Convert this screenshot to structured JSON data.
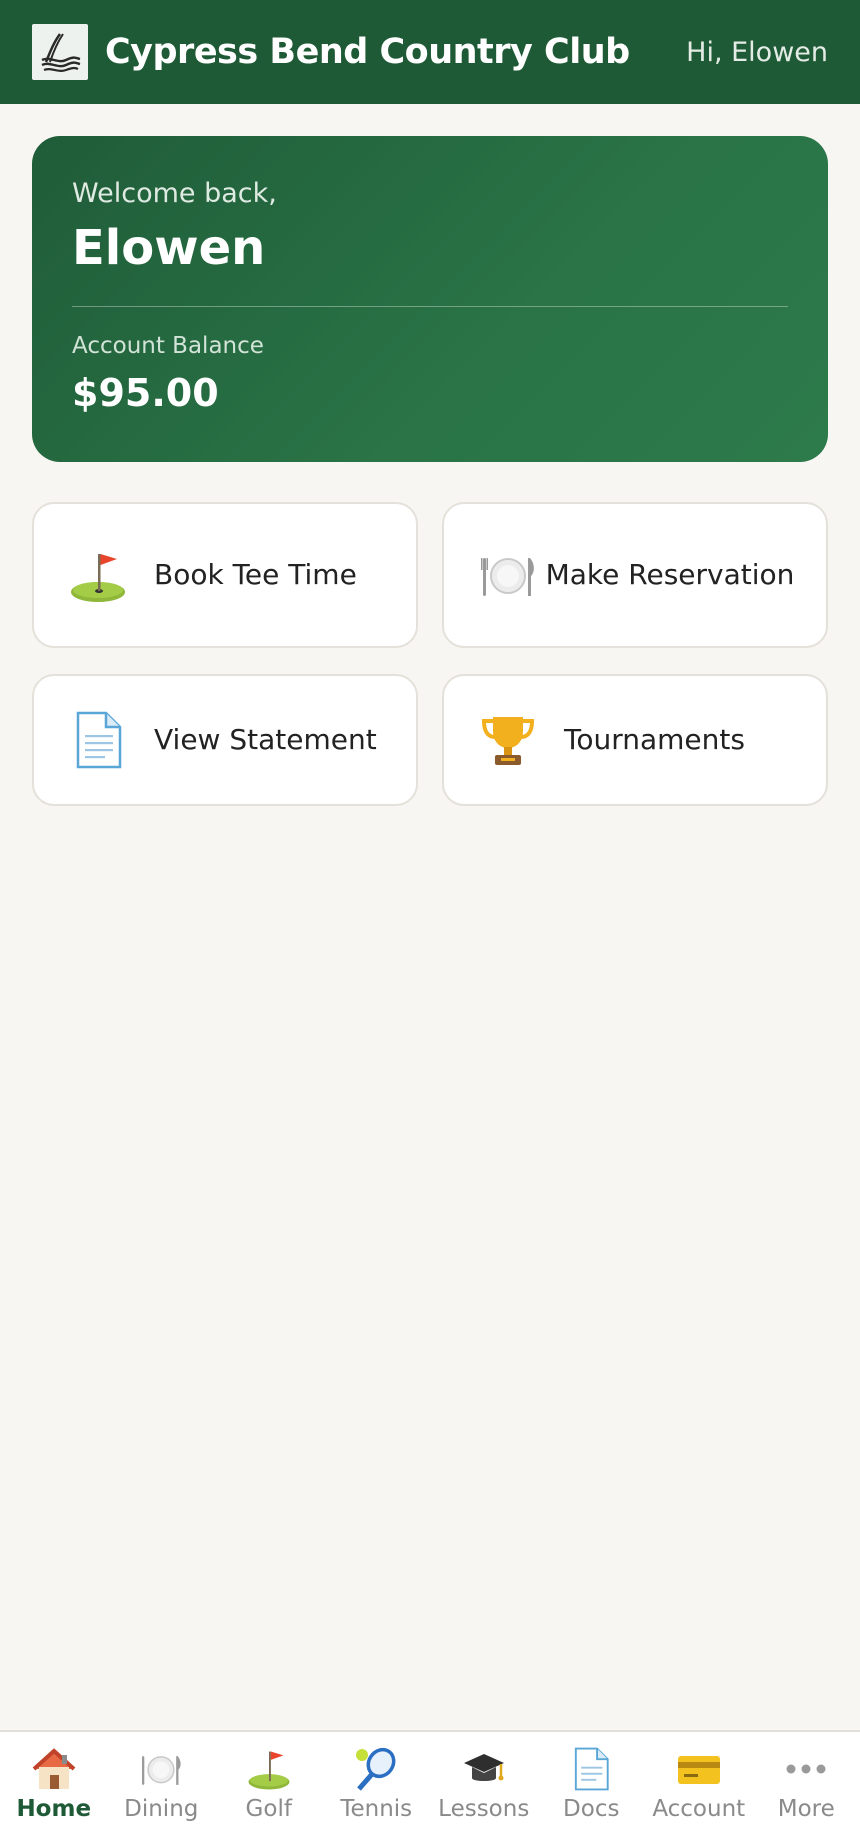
{
  "header": {
    "club_name": "Cypress Bend Country Club",
    "greeting": "Hi, Elowen",
    "logo_icon": "cypress-waves-logo",
    "background": "#1f5a36"
  },
  "welcome_card": {
    "label": "Welcome back,",
    "member_name": "Elowen",
    "balance_label": "Account Balance",
    "balance_value": "$95.00"
  },
  "quick_actions": [
    {
      "label": "Book Tee Time",
      "icon": "golf-flag-icon"
    },
    {
      "label": "Make Reservation",
      "icon": "plate-cutlery-icon"
    },
    {
      "label": "View Statement",
      "icon": "document-icon"
    },
    {
      "label": "Tournaments",
      "icon": "trophy-icon"
    }
  ],
  "bottom_nav": [
    {
      "label": "Home",
      "icon": "house-icon",
      "active": true
    },
    {
      "label": "Dining",
      "icon": "plate-cutlery-icon",
      "active": false
    },
    {
      "label": "Golf",
      "icon": "golf-flag-icon",
      "active": false
    },
    {
      "label": "Tennis",
      "icon": "tennis-racket-icon",
      "active": false
    },
    {
      "label": "Lessons",
      "icon": "graduation-cap-icon",
      "active": false
    },
    {
      "label": "Docs",
      "icon": "document-icon",
      "active": false
    },
    {
      "label": "Account",
      "icon": "credit-card-icon",
      "active": false
    },
    {
      "label": "More",
      "icon": "more-dots-icon",
      "active": false
    }
  ],
  "colors": {
    "brand_green": "#1f5a36",
    "card_green": "#2a7447",
    "page_background": "#f8f6f2",
    "active_nav": "#1f5a36",
    "inactive_nav": "#8a8a8a"
  }
}
